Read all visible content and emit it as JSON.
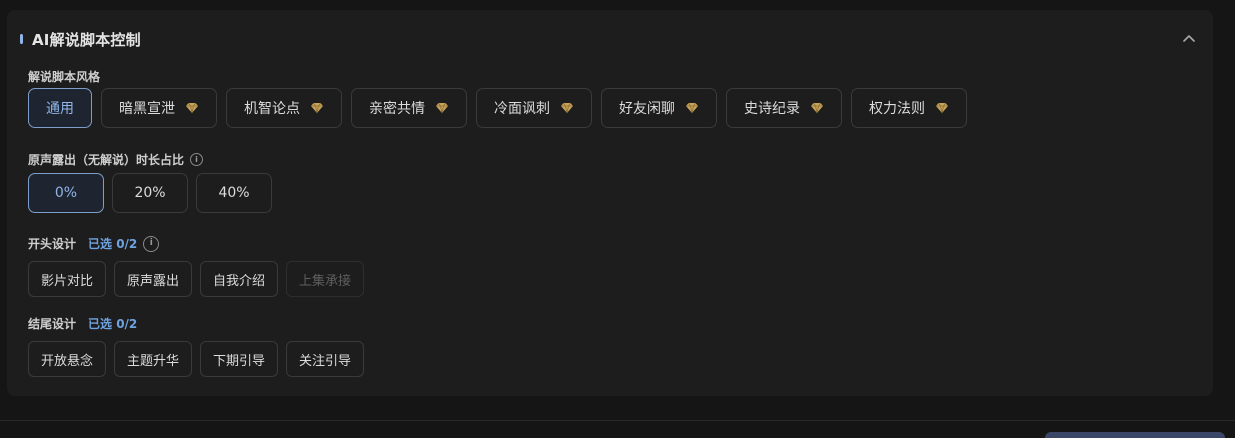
{
  "panel": {
    "title": "AI解说脚本控制",
    "accent_color": "#8fb5e8"
  },
  "style_section": {
    "label": "解说脚本风格",
    "options": [
      {
        "label": "通用",
        "selected": true,
        "premium": false
      },
      {
        "label": "暗黑宣泄",
        "selected": false,
        "premium": true
      },
      {
        "label": "机智论点",
        "selected": false,
        "premium": true
      },
      {
        "label": "亲密共情",
        "selected": false,
        "premium": true
      },
      {
        "label": "冷面讽刺",
        "selected": false,
        "premium": true
      },
      {
        "label": "好友闲聊",
        "selected": false,
        "premium": true
      },
      {
        "label": "史诗纪录",
        "selected": false,
        "premium": true
      },
      {
        "label": "权力法则",
        "selected": false,
        "premium": true
      }
    ],
    "premium_icon": "diamond-icon",
    "premium_color": "#c9a45a"
  },
  "original_audio_section": {
    "label": "原声露出（无解说）时长占比",
    "info_icon": "info-icon",
    "options": [
      {
        "label": "0%",
        "selected": true
      },
      {
        "label": "20%",
        "selected": false
      },
      {
        "label": "40%",
        "selected": false
      }
    ]
  },
  "opening_section": {
    "label": "开头设计",
    "selected_count": "已选 0/2",
    "info_icon": "info-icon",
    "options": [
      {
        "label": "影片对比",
        "disabled": false
      },
      {
        "label": "原声露出",
        "disabled": false
      },
      {
        "label": "自我介绍",
        "disabled": false
      },
      {
        "label": "上集承接",
        "disabled": true
      }
    ]
  },
  "ending_section": {
    "label": "结尾设计",
    "selected_count": "已选 0/2",
    "options": [
      {
        "label": "开放悬念",
        "disabled": false
      },
      {
        "label": "主题升华",
        "disabled": false
      },
      {
        "label": "下期引导",
        "disabled": false
      },
      {
        "label": "关注引导",
        "disabled": false
      }
    ]
  },
  "colors": {
    "background": "#151515",
    "panel": "#1d1d1d",
    "selected_border": "#7d9ec8",
    "selected_text": "#8fb5e8",
    "count_text": "#6fa3e0"
  }
}
